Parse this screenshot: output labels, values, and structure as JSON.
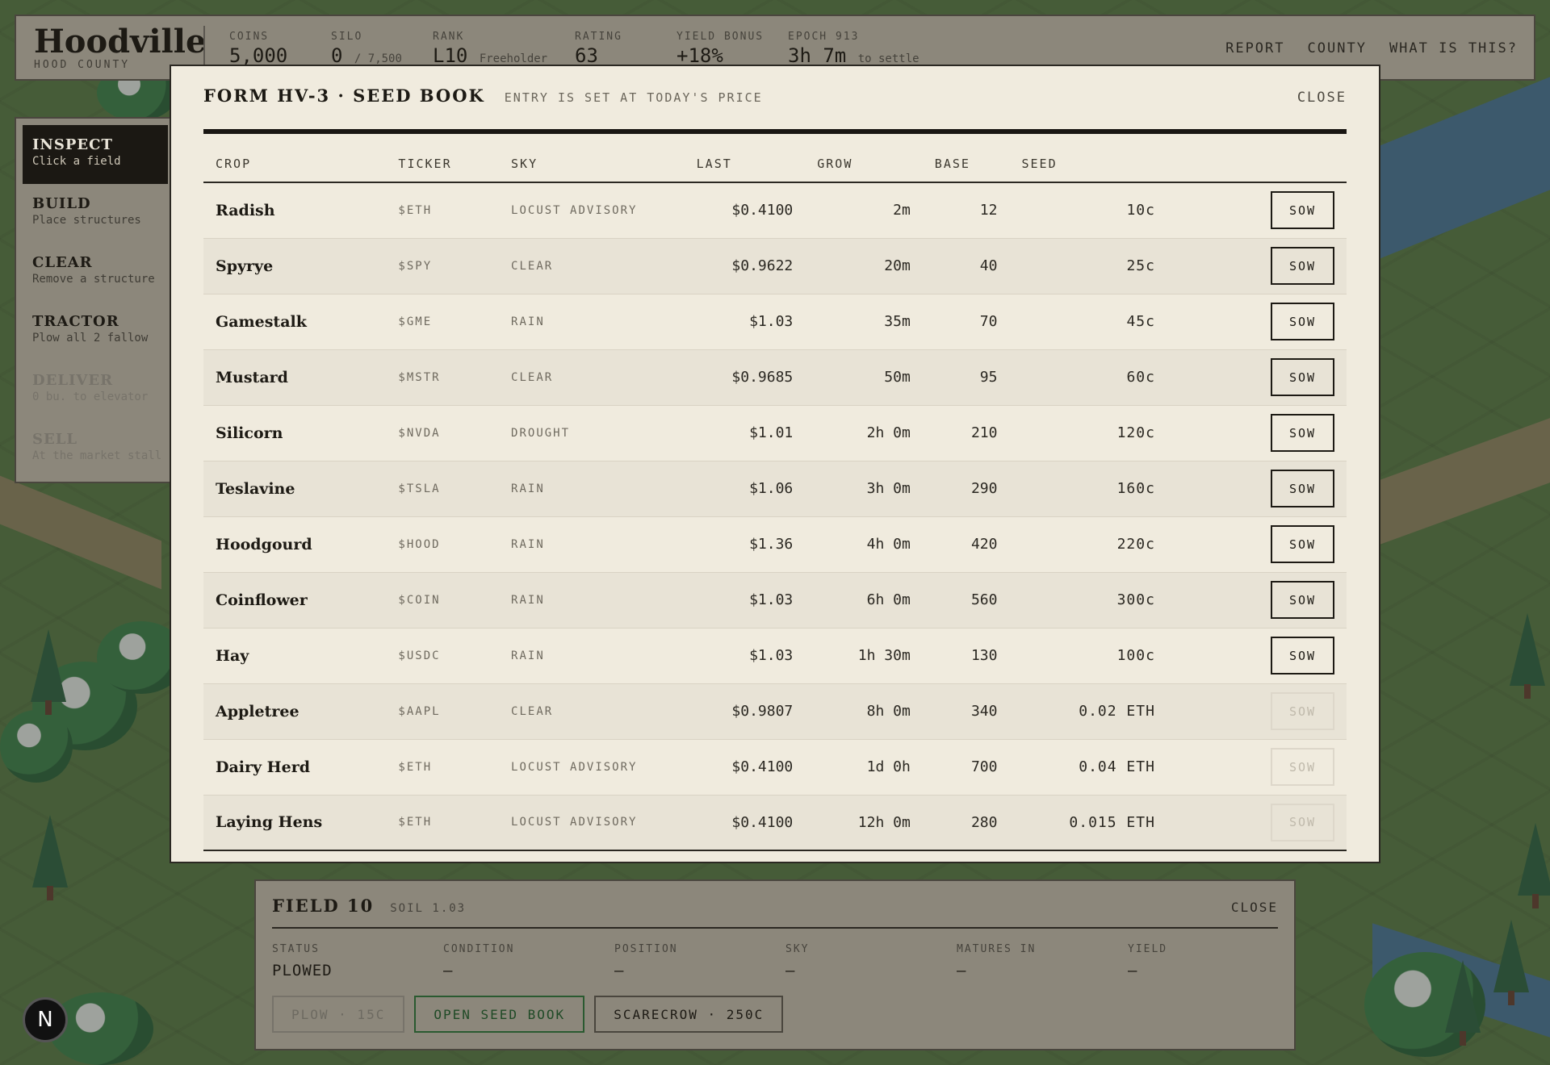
{
  "header": {
    "title": "Hoodville",
    "subtitle": "HOOD COUNTY",
    "stats": [
      {
        "label": "COINS",
        "value": "5,000",
        "suffix": ""
      },
      {
        "label": "SILO",
        "value": "0",
        "suffix": "/ 7,500"
      },
      {
        "label": "RANK",
        "value": "L10",
        "suffix": "Freeholder"
      },
      {
        "label": "RATING",
        "value": "63",
        "suffix": ""
      },
      {
        "label": "YIELD BONUS",
        "value": "+18%",
        "suffix": ""
      },
      {
        "label": "EPOCH 913",
        "value": "3h 7m",
        "suffix": "to settle"
      }
    ],
    "nav": [
      "REPORT",
      "COUNTY",
      "WHAT IS THIS?"
    ]
  },
  "tools": [
    {
      "name": "INSPECT",
      "desc": "Click a field",
      "state": "active"
    },
    {
      "name": "BUILD",
      "desc": "Place structures",
      "state": "normal"
    },
    {
      "name": "CLEAR",
      "desc": "Remove a structure",
      "state": "normal"
    },
    {
      "name": "TRACTOR",
      "desc": "Plow all 2 fallow",
      "state": "normal"
    },
    {
      "name": "DELIVER",
      "desc": "0 bu. to elevator",
      "state": "disabled"
    },
    {
      "name": "SELL",
      "desc": "At the market stall",
      "state": "disabled"
    }
  ],
  "modal": {
    "title": "FORM HV-3 · SEED BOOK",
    "subtitle": "ENTRY IS SET AT TODAY'S PRICE",
    "close_label": "CLOSE",
    "columns": [
      "CROP",
      "TICKER",
      "SKY",
      "LAST",
      "GROW",
      "BASE",
      "SEED",
      ""
    ],
    "rows": [
      {
        "crop": "Radish",
        "ticker": "$ETH",
        "sky": "LOCUST ADVISORY",
        "last": "$0.4100",
        "grow": "2m",
        "base": "12",
        "seed": "10c",
        "action": "SOW",
        "enabled": true
      },
      {
        "crop": "Spyrye",
        "ticker": "$SPY",
        "sky": "CLEAR",
        "last": "$0.9622",
        "grow": "20m",
        "base": "40",
        "seed": "25c",
        "action": "SOW",
        "enabled": true
      },
      {
        "crop": "Gamestalk",
        "ticker": "$GME",
        "sky": "RAIN",
        "last": "$1.03",
        "grow": "35m",
        "base": "70",
        "seed": "45c",
        "action": "SOW",
        "enabled": true
      },
      {
        "crop": "Mustard",
        "ticker": "$MSTR",
        "sky": "CLEAR",
        "last": "$0.9685",
        "grow": "50m",
        "base": "95",
        "seed": "60c",
        "action": "SOW",
        "enabled": true
      },
      {
        "crop": "Silicorn",
        "ticker": "$NVDA",
        "sky": "DROUGHT",
        "last": "$1.01",
        "grow": "2h 0m",
        "base": "210",
        "seed": "120c",
        "action": "SOW",
        "enabled": true
      },
      {
        "crop": "Teslavine",
        "ticker": "$TSLA",
        "sky": "RAIN",
        "last": "$1.06",
        "grow": "3h 0m",
        "base": "290",
        "seed": "160c",
        "action": "SOW",
        "enabled": true
      },
      {
        "crop": "Hoodgourd",
        "ticker": "$HOOD",
        "sky": "RAIN",
        "last": "$1.36",
        "grow": "4h 0m",
        "base": "420",
        "seed": "220c",
        "action": "SOW",
        "enabled": true
      },
      {
        "crop": "Coinflower",
        "ticker": "$COIN",
        "sky": "RAIN",
        "last": "$1.03",
        "grow": "6h 0m",
        "base": "560",
        "seed": "300c",
        "action": "SOW",
        "enabled": true
      },
      {
        "crop": "Hay",
        "ticker": "$USDC",
        "sky": "RAIN",
        "last": "$1.03",
        "grow": "1h 30m",
        "base": "130",
        "seed": "100c",
        "action": "SOW",
        "enabled": true
      },
      {
        "crop": "Appletree",
        "ticker": "$AAPL",
        "sky": "CLEAR",
        "last": "$0.9807",
        "grow": "8h 0m",
        "base": "340",
        "seed": "0.02 ETH",
        "action": "SOW",
        "enabled": false
      },
      {
        "crop": "Dairy Herd",
        "ticker": "$ETH",
        "sky": "LOCUST ADVISORY",
        "last": "$0.4100",
        "grow": "1d 0h",
        "base": "700",
        "seed": "0.04 ETH",
        "action": "SOW",
        "enabled": false
      },
      {
        "crop": "Laying Hens",
        "ticker": "$ETH",
        "sky": "LOCUST ADVISORY",
        "last": "$0.4100",
        "grow": "12h 0m",
        "base": "280",
        "seed": "0.015 ETH",
        "action": "SOW",
        "enabled": false
      }
    ]
  },
  "field": {
    "title": "FIELD 10",
    "soil": "SOIL 1.03",
    "close_label": "CLOSE",
    "cells": [
      {
        "label": "STATUS",
        "value": "PLOWED"
      },
      {
        "label": "CONDITION",
        "value": "—"
      },
      {
        "label": "POSITION",
        "value": "—"
      },
      {
        "label": "SKY",
        "value": "—"
      },
      {
        "label": "MATURES IN",
        "value": "—"
      },
      {
        "label": "YIELD",
        "value": "—"
      }
    ],
    "actions": [
      {
        "label": "PLOW · 15C",
        "style": "dis"
      },
      {
        "label": "OPEN SEED BOOK",
        "style": "ok"
      },
      {
        "label": "SCARECROW · 250C",
        "style": "normal"
      }
    ]
  },
  "badge": "N",
  "colors": {
    "paper": "#f0ebde",
    "ink": "#1d1a14",
    "grass": "#4e7436",
    "water": "#3d6e8f"
  }
}
